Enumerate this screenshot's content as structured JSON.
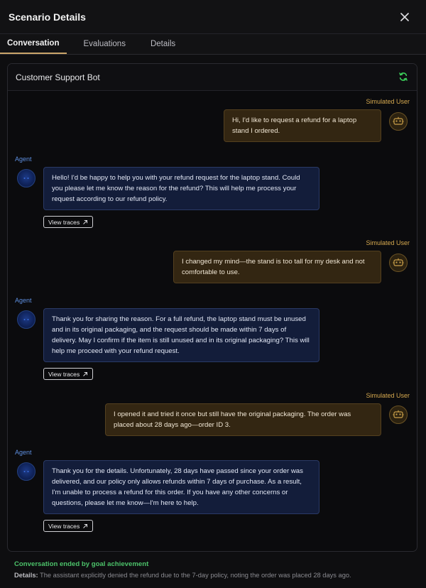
{
  "header": {
    "title": "Scenario Details"
  },
  "tabs": [
    {
      "label": "Conversation",
      "active": true
    },
    {
      "label": "Evaluations",
      "active": false
    },
    {
      "label": "Details",
      "active": false
    }
  ],
  "panel": {
    "title": "Customer Support Bot",
    "refresh_icon": "refresh-icon"
  },
  "messages": [
    {
      "role": "user",
      "label": "Simulated User",
      "text": "Hi, I'd like to request a refund for a laptop stand I ordered."
    },
    {
      "role": "agent",
      "label": "Agent",
      "text": "Hello! I'd be happy to help you with your refund request for the laptop stand. Could you please let me know the reason for the refund? This will help me process your request according to our refund policy.",
      "trace_label": "View traces"
    },
    {
      "role": "user",
      "label": "Simulated User",
      "text": "I changed my mind—the stand is too tall for my desk and not comfortable to use."
    },
    {
      "role": "agent",
      "label": "Agent",
      "text": "Thank you for sharing the reason. For a full refund, the laptop stand must be unused and in its original packaging, and the request should be made within 7 days of delivery. May I confirm if the item is still unused and in its original packaging? This will help me proceed with your refund request.",
      "trace_label": "View traces"
    },
    {
      "role": "user",
      "label": "Simulated User",
      "text": "I opened it and tried it once but still have the original packaging. The order was placed about 28 days ago—order ID 3."
    },
    {
      "role": "agent",
      "label": "Agent",
      "text": "Thank you for the details. Unfortunately, 28 days have passed since your order was delivered, and our policy only allows refunds within 7 days of purchase. As a result, I'm unable to process a refund for this order. If you have any other concerns or questions, please let me know—I'm here to help.",
      "trace_label": "View traces"
    }
  ],
  "footer": {
    "status": "Conversation ended by goal achievement",
    "details_label": "Details:",
    "details_text": "The assistant explicitly denied the refund due to the 7-day policy, noting the order was placed 28 days ago."
  },
  "colors": {
    "accent_tab": "#caa46a",
    "user_label": "#d6a94f",
    "agent_label": "#5e8fe0",
    "success": "#4cc26a",
    "refresh": "#3ccf5a"
  }
}
